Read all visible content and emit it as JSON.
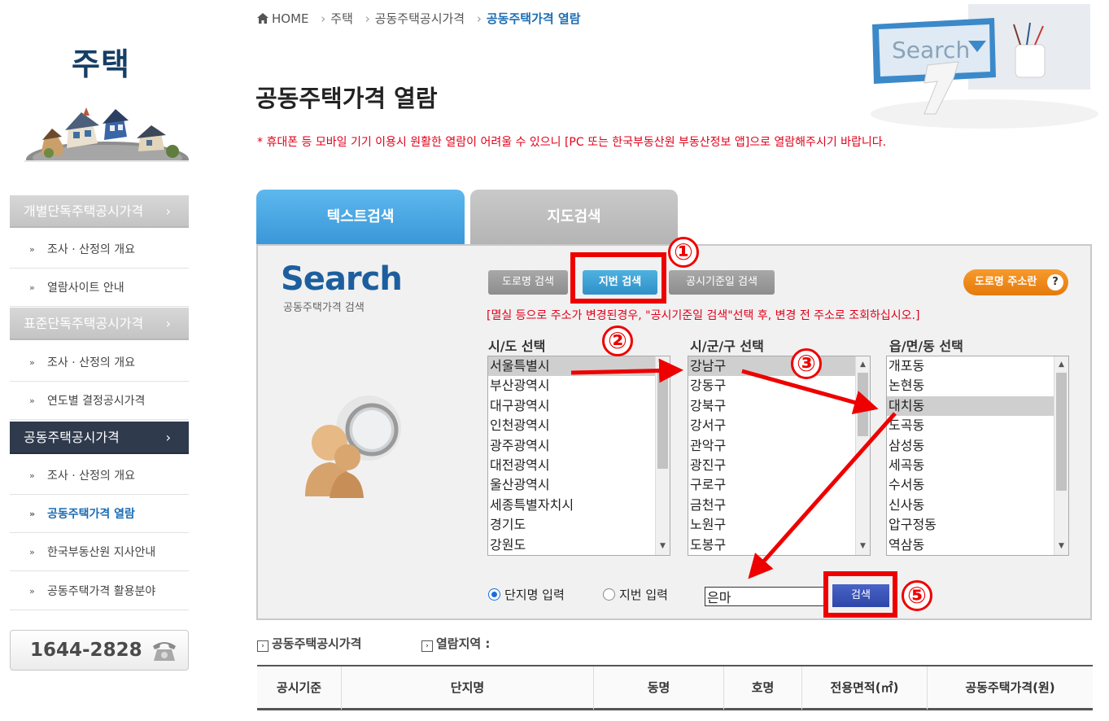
{
  "sidebar": {
    "title": "주택",
    "menu": [
      {
        "label": "개별단독주택공시가격",
        "type": "category"
      },
      {
        "label": "조사 · 산정의 개요",
        "type": "sub"
      },
      {
        "label": "열람사이트 안내",
        "type": "sub"
      },
      {
        "label": "표준단독주택공시가격",
        "type": "category"
      },
      {
        "label": "조사 · 산정의 개요",
        "type": "sub"
      },
      {
        "label": "연도별 결정공시가격",
        "type": "sub"
      },
      {
        "label": "공동주택공시가격",
        "type": "category-active"
      },
      {
        "label": "조사 · 산정의 개요",
        "type": "sub"
      },
      {
        "label": "공동주택가격 열람",
        "type": "sub-current"
      },
      {
        "label": "한국부동산원 지사안내",
        "type": "sub"
      },
      {
        "label": "공동주택가격 활용분야",
        "type": "sub"
      }
    ],
    "chevron": "›",
    "bullet": "»",
    "phone": "1644-2828"
  },
  "breadcrumb": {
    "home": "HOME",
    "items": [
      "주택",
      "공동주택공시가격"
    ],
    "current": "공동주택가격 열람",
    "separator": "›"
  },
  "header": {
    "page_title": "공동주택가격 열람",
    "notice": "* 휴대폰 등 모바일 기기 이용시 원활한 열람이 어려울 수 있으니 [PC 또는 한국부동산원 부동산정보 앱]으로 열람해주시기 바랍니다.",
    "illus_search_text": "Search"
  },
  "tabs": {
    "text_search": "텍스트검색",
    "map_search": "지도검색"
  },
  "search": {
    "logo": "Search",
    "logo_sub": "공동주택가격 검색",
    "mode_road": "도로명 검색",
    "mode_jibun": "지번 검색",
    "mode_date": "공시기준일 검색",
    "addr_button": "도로명 주소란",
    "addr_help": "?",
    "warning": "[멸실 등으로 주소가 변경된경우, \"공시기준일 검색\"선택 후, 변경 전 주소로 조회하십시오.]",
    "sido_header": "시/도 선택",
    "sigungu_header": "시/군/구 선택",
    "dong_header": "읍/면/동 선택",
    "sido_list": [
      "서울특별시",
      "부산광역시",
      "대구광역시",
      "인천광역시",
      "광주광역시",
      "대전광역시",
      "울산광역시",
      "세종특별자치시",
      "경기도",
      "강원도"
    ],
    "sido_selected": 0,
    "sigungu_list": [
      "강남구",
      "강동구",
      "강북구",
      "강서구",
      "관악구",
      "광진구",
      "구로구",
      "금천구",
      "노원구",
      "도봉구"
    ],
    "sigungu_selected": 0,
    "dong_list": [
      "개포동",
      "논현동",
      "대치동",
      "도곡동",
      "삼성동",
      "세곡동",
      "수서동",
      "신사동",
      "압구정동",
      "역삼동"
    ],
    "dong_selected": 2,
    "radio_complex": "단지명 입력",
    "radio_jibun": "지번 입력",
    "radio_selected": "complex",
    "input_value": "은마",
    "search_button": "검색"
  },
  "annotations": {
    "step1": "①",
    "step2": "②",
    "step3": "③",
    "step5": "⑤",
    "color": "#ee0000"
  },
  "results": {
    "label_price": "공동주택공시가격",
    "label_region": "열람지역 :",
    "label_icon": "›",
    "columns": [
      "공시기준",
      "단지명",
      "동명",
      "호명",
      "전용면적(㎡)",
      "공동주택가격(원)"
    ]
  },
  "colors": {
    "accent_blue": "#3a97d8",
    "sidebar_active": "#2f3a4d",
    "warning_red": "#e1001a",
    "search_button": "#2e46a8",
    "addr_button": "#e57a0b"
  }
}
